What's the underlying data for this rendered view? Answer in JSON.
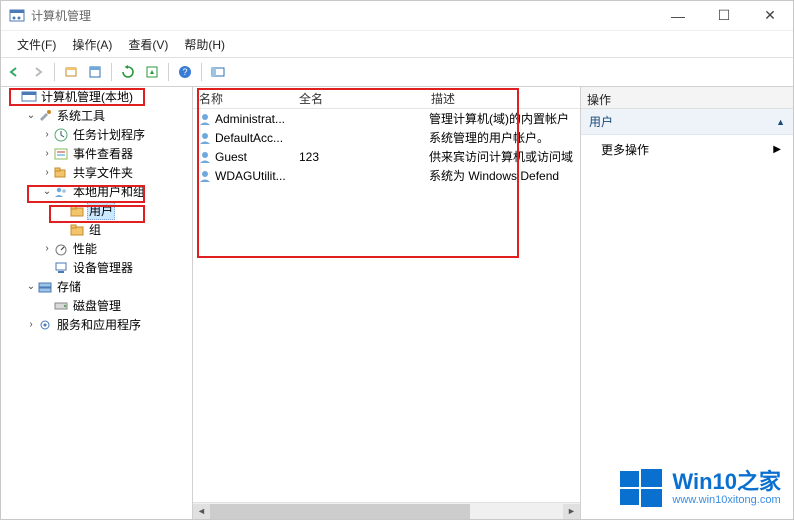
{
  "window": {
    "title": "计算机管理",
    "controls": {
      "min": "—",
      "max": "☐",
      "close": "✕"
    }
  },
  "menu": [
    "文件(F)",
    "操作(A)",
    "查看(V)",
    "帮助(H)"
  ],
  "tree": {
    "root": "计算机管理(本地)",
    "items": [
      {
        "label": "系统工具",
        "level": 2,
        "expanded": true,
        "icon": "tools"
      },
      {
        "label": "任务计划程序",
        "level": 3,
        "expanded": false,
        "icon": "clock"
      },
      {
        "label": "事件查看器",
        "level": 3,
        "expanded": false,
        "icon": "event"
      },
      {
        "label": "共享文件夹",
        "level": 3,
        "expanded": false,
        "icon": "share"
      },
      {
        "label": "本地用户和组",
        "level": 3,
        "expanded": true,
        "icon": "users"
      },
      {
        "label": "用户",
        "level": 4,
        "expanded": null,
        "icon": "folder",
        "selected": true
      },
      {
        "label": "组",
        "level": 4,
        "expanded": null,
        "icon": "folder"
      },
      {
        "label": "性能",
        "level": 3,
        "expanded": false,
        "icon": "perf"
      },
      {
        "label": "设备管理器",
        "level": 3,
        "expanded": null,
        "icon": "device"
      },
      {
        "label": "存储",
        "level": 2,
        "expanded": true,
        "icon": "storage"
      },
      {
        "label": "磁盘管理",
        "level": 3,
        "expanded": null,
        "icon": "disk"
      },
      {
        "label": "服务和应用程序",
        "level": 2,
        "expanded": false,
        "icon": "service"
      }
    ]
  },
  "list": {
    "columns": {
      "name": "名称",
      "full": "全名",
      "desc": "描述"
    },
    "rows": [
      {
        "name": "Administrat...",
        "full": "",
        "desc": "管理计算机(域)的内置帐户"
      },
      {
        "name": "DefaultAcc...",
        "full": "",
        "desc": "系统管理的用户帐户。"
      },
      {
        "name": "Guest",
        "full": "123",
        "desc": "供来宾访问计算机或访问域"
      },
      {
        "name": "WDAGUtilit...",
        "full": "",
        "desc": "系统为 Windows Defend"
      }
    ]
  },
  "actions": {
    "head": "操作",
    "section_title": "用户",
    "more": "更多操作"
  },
  "watermark": {
    "brand": "Win10",
    "suffix": "之家",
    "url": "www.win10xitong.com"
  }
}
